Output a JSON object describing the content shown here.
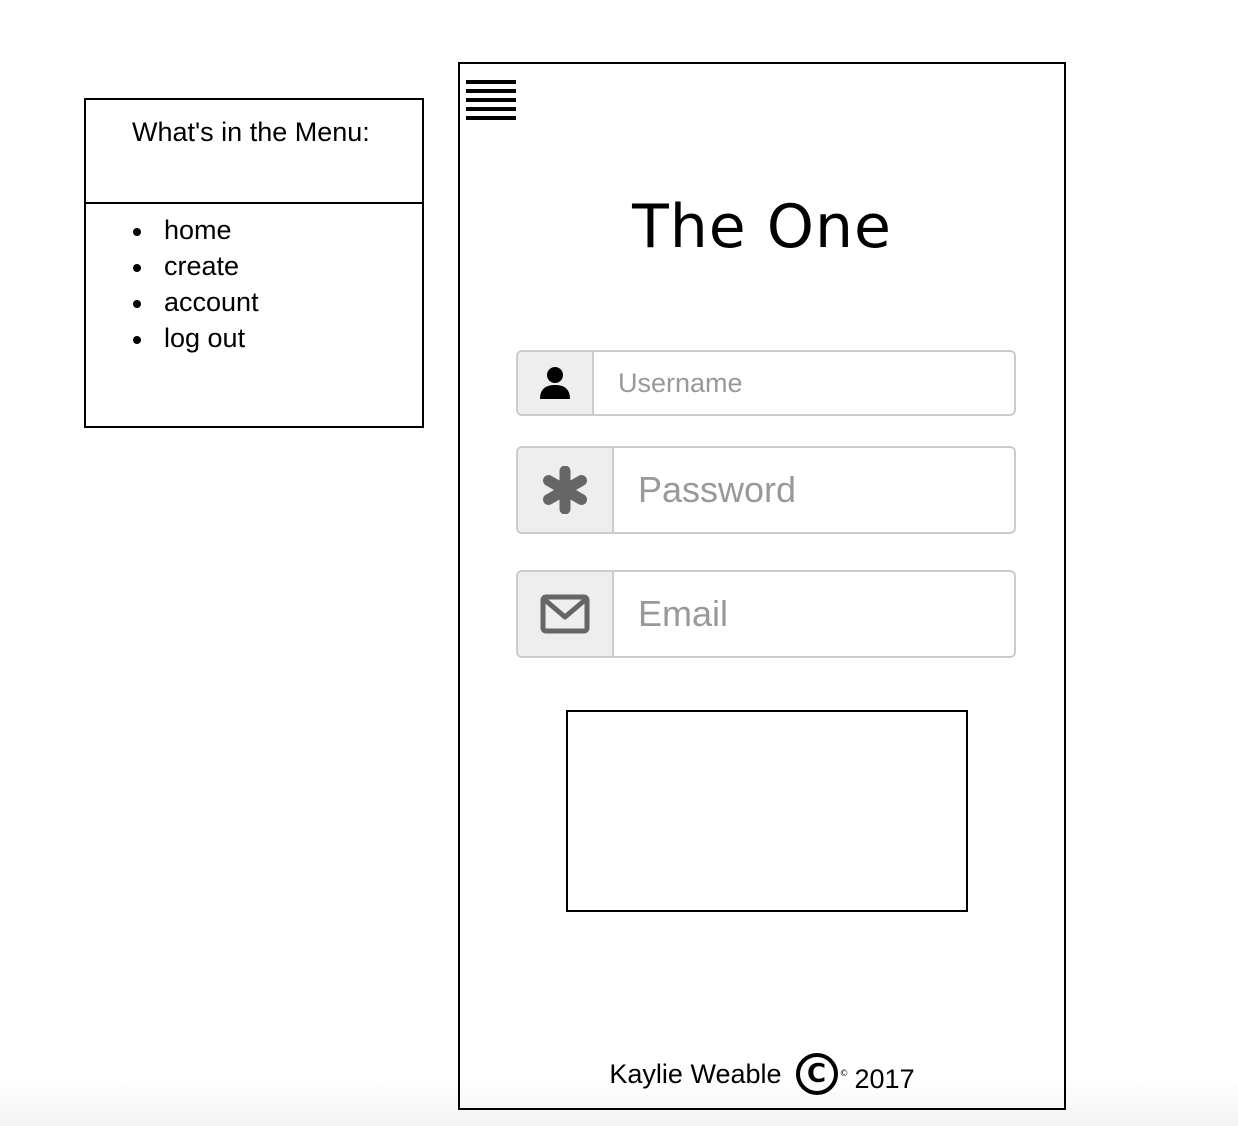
{
  "menu_legend": {
    "title": "What's in the Menu:",
    "items": [
      "home",
      "create",
      "account",
      "log out"
    ]
  },
  "app": {
    "title": "The One",
    "menu_icon": "hamburger-icon"
  },
  "form": {
    "username": {
      "placeholder": "Username",
      "icon": "user-icon"
    },
    "password": {
      "placeholder": "Password",
      "icon": "asterisk-icon"
    },
    "email": {
      "placeholder": "Email",
      "icon": "envelope-icon"
    }
  },
  "footer": {
    "author": "Kaylie Weable",
    "copyright_symbol": "C",
    "copyright_small": "©",
    "year": "2017"
  },
  "colors": {
    "border": "#000000",
    "input_border": "#cccccc",
    "addon_bg": "#eeeeee",
    "icon_gray": "#666666",
    "placeholder": "#999999"
  }
}
